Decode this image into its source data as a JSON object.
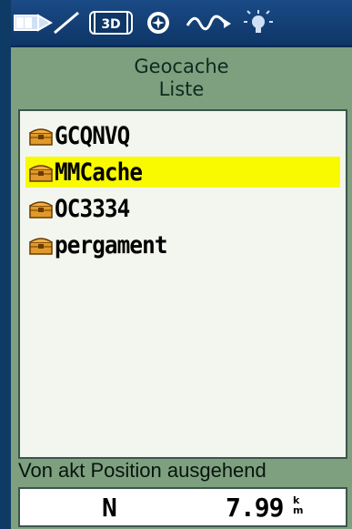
{
  "toolbar": {
    "icons": [
      "battery-icon",
      "signal-icon",
      "3d-fix-icon",
      "compass-icon",
      "satellite-icon",
      "backlight-icon"
    ],
    "fix_label": "3D"
  },
  "header": {
    "line1": "Geocache",
    "line2": "Liste"
  },
  "list": {
    "items": [
      {
        "label": "GCQNVQ",
        "selected": false
      },
      {
        "label": "MMCache",
        "selected": true
      },
      {
        "label": "OC3334",
        "selected": false
      },
      {
        "label": "pergament",
        "selected": false
      }
    ]
  },
  "footer": {
    "reference_label": "Von akt Position ausgehend",
    "direction": "N",
    "distance": "7.99",
    "unit_top": "k",
    "unit_bottom": "m"
  },
  "colors": {
    "background": "#7fa07e",
    "toolbar": "#123f78",
    "selection": "#f9f900",
    "chest": "#e09a2a"
  }
}
